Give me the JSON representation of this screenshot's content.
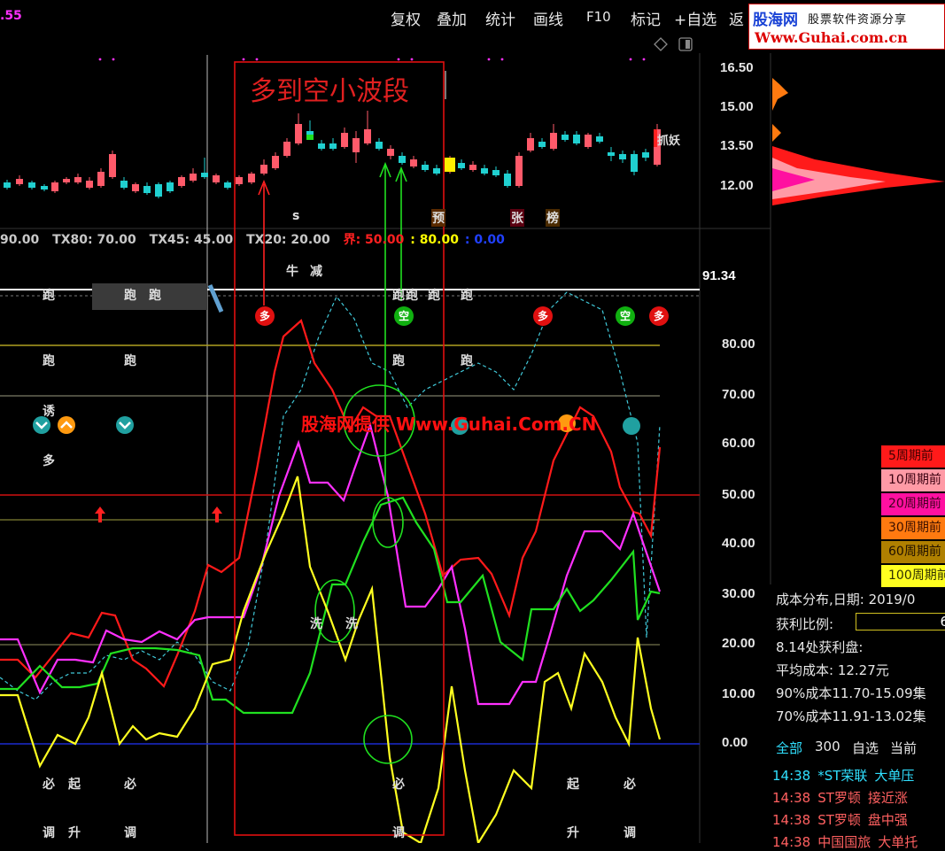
{
  "toolbar": {
    "price_fragment": ".55",
    "buttons": [
      "复权",
      "叠加",
      "统计",
      "画线",
      "F10",
      "标记",
      "+自选",
      "返"
    ]
  },
  "brand": {
    "logo": "股海网",
    "tagline": "股票软件资源分享",
    "url": "Www.Guhai.com.cn"
  },
  "price_axis": [
    "16.50",
    "15.00",
    "13.50",
    "12.00"
  ],
  "indicator_axis": [
    "91.34",
    "80.00",
    "70.00",
    "60.00",
    "50.00",
    "40.00",
    "30.00",
    "20.00",
    "10.00",
    "0.00"
  ],
  "indicator_params": [
    {
      "text": "90.00",
      "color": "#c8c8c8"
    },
    {
      "text": "TX80: 70.00",
      "color": "#c8c8c8"
    },
    {
      "text": "TX45: 45.00",
      "color": "#c8c8c8"
    },
    {
      "text": "TX20: 20.00",
      "color": "#c8c8c8"
    },
    {
      "text": "界: 50.00",
      "color": "#ff2020"
    },
    {
      "text": ": 80.00",
      "color": "#ffff00"
    },
    {
      "text": ": 0.00",
      "color": "#2040ff"
    }
  ],
  "annotations": {
    "zone_title": "多到空小波段",
    "watermark": "股海网提供 Www.Guhai.Com.CN",
    "price_marks": [
      {
        "text": "s",
        "color": "#ff3030"
      },
      {
        "text": "预",
        "color": "#ff9040"
      },
      {
        "text": "张",
        "color": "#ff5050"
      },
      {
        "text": "榜",
        "color": "#ff9040"
      },
      {
        "text": "抓妖",
        "color": "#ffd040"
      }
    ],
    "signals": [
      {
        "text": "牛",
        "color": "#ff3030"
      },
      {
        "text": "减",
        "color": "#20e020"
      },
      {
        "text": "跑",
        "color": "#20e020"
      },
      {
        "text": "跑",
        "color": "#20e020"
      },
      {
        "text": "跑",
        "color": "#20e020"
      },
      {
        "text": "跑",
        "color": "#20e020"
      },
      {
        "text": "跑",
        "color": "#20e020"
      },
      {
        "text": "跑",
        "color": "#20e020"
      },
      {
        "text": "跑",
        "color": "#20e020"
      },
      {
        "text": "跑",
        "color": "#20e020"
      },
      {
        "text": "跑",
        "color": "#20e020"
      },
      {
        "text": "跑",
        "color": "#20e020"
      },
      {
        "text": "跑",
        "color": "#20e020"
      },
      {
        "text": "跑",
        "color": "#20e020"
      },
      {
        "text": "诱",
        "color": "#20e020"
      },
      {
        "text": "多",
        "color": "#20e020"
      },
      {
        "text": "洗",
        "color": "#20e020"
      },
      {
        "text": "洗",
        "color": "#20e020"
      },
      {
        "text": "必",
        "color": "#20e020"
      },
      {
        "text": "起",
        "color": "#ff3030"
      },
      {
        "text": "必",
        "color": "#20e020"
      },
      {
        "text": "必",
        "color": "#20e020"
      },
      {
        "text": "起",
        "color": "#ff3030"
      },
      {
        "text": "必",
        "color": "#20e020"
      },
      {
        "text": "调",
        "color": "#20e020"
      },
      {
        "text": "升",
        "color": "#ff3030"
      },
      {
        "text": "调",
        "color": "#20e020"
      },
      {
        "text": "调",
        "color": "#20e020"
      },
      {
        "text": "升",
        "color": "#ff3030"
      },
      {
        "text": "调",
        "color": "#20e020"
      }
    ],
    "badges": [
      {
        "text": "多",
        "kind": "red"
      },
      {
        "text": "空",
        "kind": "green"
      },
      {
        "text": "多",
        "kind": "red"
      },
      {
        "text": "空",
        "kind": "green"
      },
      {
        "text": "多",
        "kind": "red"
      }
    ]
  },
  "legend": [
    {
      "label": "5周期前",
      "bg": "#ff1a1a",
      "fg": "#400000"
    },
    {
      "label": "10周期前",
      "bg": "#ff9aa6",
      "fg": "#3a0010"
    },
    {
      "label": "20周期前",
      "bg": "#ff10a0",
      "fg": "#400020"
    },
    {
      "label": "30周期前",
      "bg": "#ff7a10",
      "fg": "#3a1000"
    },
    {
      "label": "60周期前",
      "bg": "#b08000",
      "fg": "#201000"
    },
    {
      "label": "100周期前",
      "bg": "#ffff20",
      "fg": "#303000"
    }
  ],
  "cost_stats": {
    "title": "成本分布,日期: 2019/0",
    "profit_label": "获利比例:",
    "profit_value": "6",
    "line1": "8.14处获利盘:",
    "line2": "平均成本: 12.27元",
    "line3": "90%成本11.70-15.09集",
    "line4": "70%成本11.91-13.02集"
  },
  "tabs": {
    "all": "全部",
    "count": "300",
    "watch": "自选",
    "current": "当前"
  },
  "trades": [
    {
      "time": "14:38",
      "name": "*ST荣联",
      "action": "大单压",
      "color": "#30e0ff"
    },
    {
      "time": "14:38",
      "name": "ST罗顿",
      "action": "接近涨",
      "color": "#ff6060"
    },
    {
      "time": "14:38",
      "name": "ST罗顿",
      "action": "盘中强",
      "color": "#ff6060"
    },
    {
      "time": "14:38",
      "name": "中国国旅",
      "action": "大单托",
      "color": "#ff6060"
    }
  ]
}
